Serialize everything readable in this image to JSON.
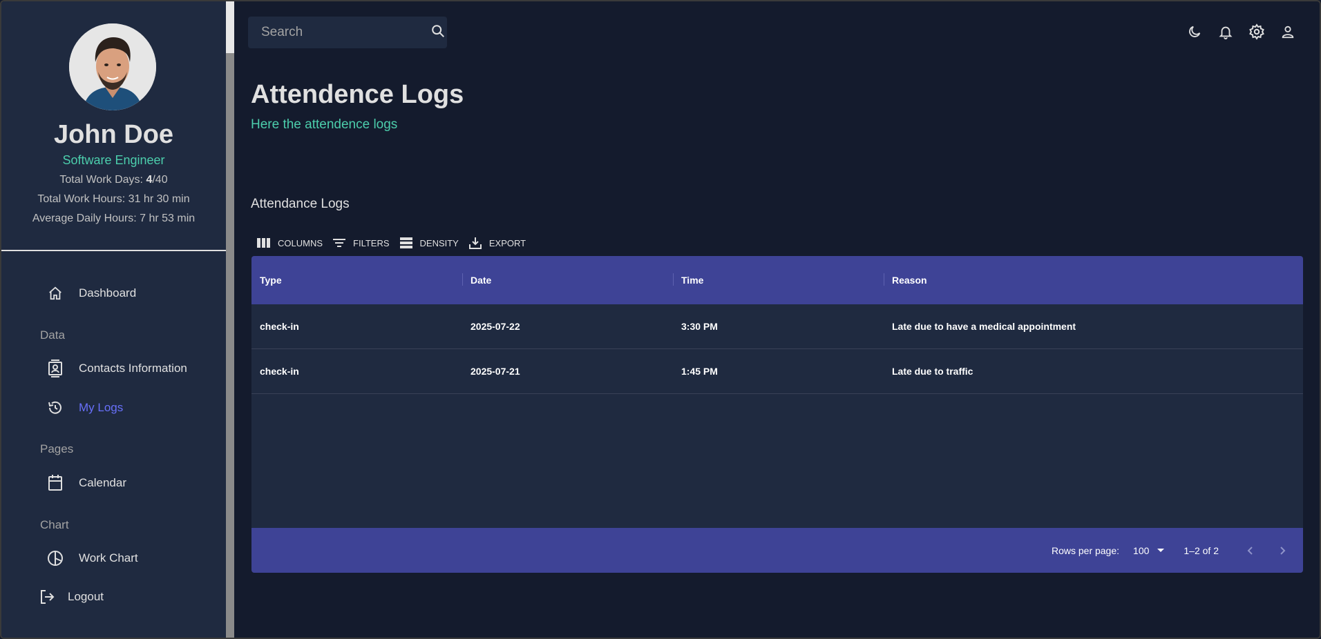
{
  "profile": {
    "name": "John Doe",
    "role": "Software Engineer",
    "work_days_label": "Total Work Days: ",
    "work_days_value": "4",
    "work_days_total": "/40",
    "work_hours": "Total Work Hours: 31 hr 30 min",
    "avg_hours": "Average Daily Hours: 7 hr 53 min"
  },
  "sidebar": {
    "dashboard": "Dashboard",
    "section_data": "Data",
    "contacts": "Contacts Information",
    "my_logs": "My Logs",
    "section_pages": "Pages",
    "calendar": "Calendar",
    "section_chart": "Chart",
    "work_chart": "Work Chart",
    "logout": "Logout"
  },
  "search": {
    "placeholder": "Search"
  },
  "header": {
    "title": "Attendence Logs",
    "subtitle": "Here the attendence logs"
  },
  "grid": {
    "title": "Attendance Logs",
    "toolbar": {
      "columns": "Columns",
      "filters": "Filters",
      "density": "Density",
      "export": "Export"
    },
    "columns": [
      "Type",
      "Date",
      "Time",
      "Reason"
    ],
    "rows": [
      [
        "check-in",
        "2025-07-22",
        "3:30 PM",
        "Late due to have a medical appointment"
      ],
      [
        "check-in",
        "2025-07-21",
        "1:45 PM",
        "Late due to traffic"
      ]
    ],
    "footer": {
      "rows_per_page_label": "Rows per page:",
      "rows_per_page_value": "100",
      "range": "1–2 of 2"
    }
  },
  "colors": {
    "sidebar_bg": "#1f2a40",
    "body_bg": "#141b2d",
    "accent_green": "#4cceac",
    "accent_purple": "#6870fa",
    "grid_header_bg": "#3e4396"
  }
}
